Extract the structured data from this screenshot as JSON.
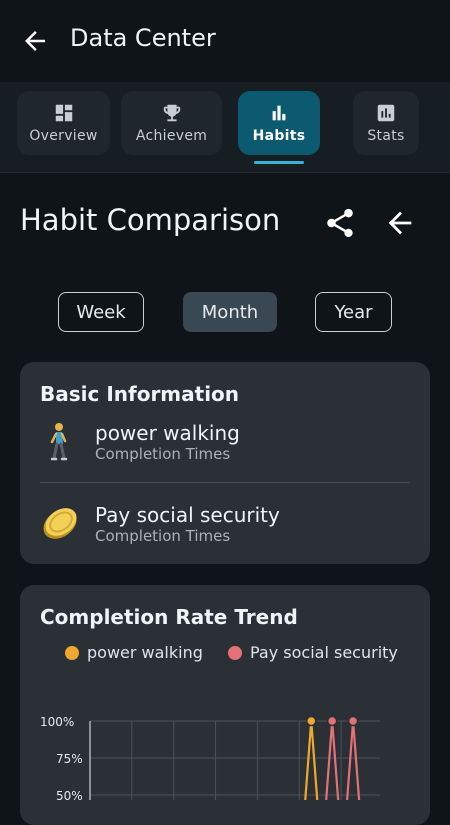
{
  "appbar": {
    "title": "Data Center"
  },
  "tabs": [
    {
      "label": "Overview",
      "icon": "dashboard-icon"
    },
    {
      "label": "Achievem",
      "icon": "trophy-icon"
    },
    {
      "label": "Habits",
      "icon": "bar-chart-icon",
      "active": true
    },
    {
      "label": "Stats",
      "icon": "stats-icon"
    }
  ],
  "section": {
    "title": "Habit Comparison"
  },
  "periods": [
    {
      "label": "Week"
    },
    {
      "label": "Month",
      "selected": true
    },
    {
      "label": "Year"
    }
  ],
  "basic_info": {
    "title": "Basic Information",
    "habits": [
      {
        "name": "power walking",
        "subtitle": "Completion Times",
        "icon": "person-walking-icon"
      },
      {
        "name": "Pay social security",
        "subtitle": "Completion Times",
        "icon": "coin-icon"
      }
    ]
  },
  "trend": {
    "title": "Completion Rate Trend",
    "legend": [
      {
        "name": "power walking",
        "color": "#f0a92e"
      },
      {
        "name": "Pay social security",
        "color": "#e37178"
      }
    ]
  },
  "chart_data": {
    "type": "line",
    "y_tick_labels": [
      "100%",
      "75%",
      "50%"
    ],
    "ylim": [
      0,
      100
    ],
    "grid": true,
    "series": [
      {
        "name": "power walking",
        "color": "#f0a92e",
        "peaks_at_100_on_columns": [
          5,
          7
        ]
      },
      {
        "name": "Pay social security",
        "color": "#e37178",
        "peaks_at_100_on_columns": [
          5.5,
          6
        ]
      }
    ]
  },
  "colors": {
    "background": "#0f1419",
    "card": "#2a3036",
    "accent": "#35b5d6",
    "active_tab": "#0b5a70"
  }
}
